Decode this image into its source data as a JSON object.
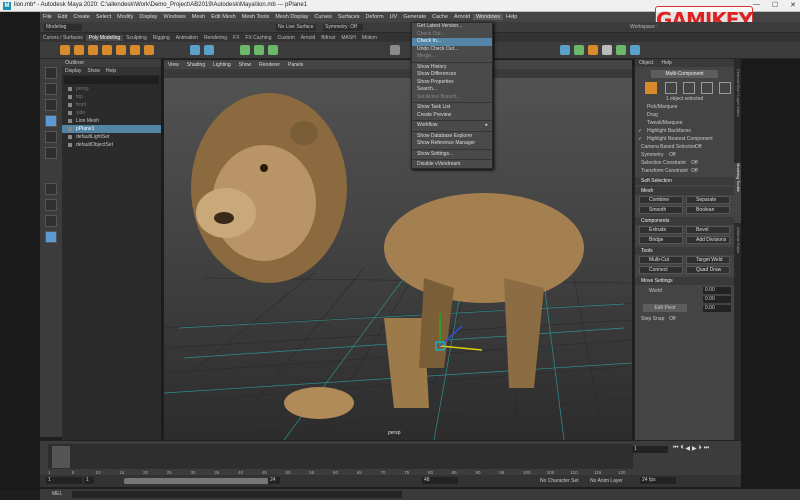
{
  "window": {
    "title": "lion.mb* - Autodesk Maya 2020: C:\\allendesk\\Work\\Demo_Project\\AB2019\\Autodesk\\Maya\\lion.mb  ---  pPlane1",
    "controls": [
      "—",
      "☐",
      "✕"
    ]
  },
  "watermark": "GAMIKEY",
  "menubar": [
    "File",
    "Edit",
    "Create",
    "Select",
    "Modify",
    "Display",
    "Windows",
    "Mesh",
    "Edit Mesh",
    "Mesh Tools",
    "Mesh Display",
    "Curves",
    "Surfaces",
    "Deform",
    "UV",
    "Generate",
    "Cache",
    "Arnold",
    "Wondows",
    "Help"
  ],
  "status_line": {
    "mode": "Modeling",
    "no_live": "No Live Surface",
    "symmetry": "Symmetry: Off",
    "workspace": "Workspace :"
  },
  "shelf_tabs": [
    "Curves / Surfaces",
    "Poly Modeling",
    "Sculpting",
    "Rigging",
    "Animation",
    "Rendering",
    "FX",
    "FX Caching",
    "Custom",
    "Arnold",
    "Bifrost",
    "MASH",
    "Motion"
  ],
  "active_shelf": "Poly Modeling",
  "outliner": {
    "title": "Outliner",
    "menu": [
      "Display",
      "Show",
      "Help"
    ],
    "items": [
      "persp",
      "top",
      "front",
      "side",
      "Lion Mesh",
      "pPlane1",
      "defaultLightSet",
      "defaultObjectSet"
    ],
    "selected": "pPlane1"
  },
  "viewport": {
    "menus": [
      "View",
      "Shading",
      "Lighting",
      "Show",
      "Renderer",
      "Panels"
    ],
    "camera": "persp"
  },
  "dropdown": [
    {
      "label": "Get Latest Version...",
      "state": "normal"
    },
    {
      "label": "Check Out...",
      "state": "disabled"
    },
    {
      "label": "Check In...",
      "state": "highlight"
    },
    {
      "label": "Undo Check Out...",
      "state": "normal"
    },
    {
      "label": "Merge...",
      "state": "disabled"
    },
    {
      "sep": true
    },
    {
      "label": "Show History",
      "state": "normal"
    },
    {
      "label": "Show Differences",
      "state": "normal"
    },
    {
      "label": "Show Properties",
      "state": "normal"
    },
    {
      "label": "Search...",
      "state": "normal"
    },
    {
      "label": "Set Active Branch...",
      "state": "disabled"
    },
    {
      "sep": true
    },
    {
      "label": "Show Task List",
      "state": "normal"
    },
    {
      "label": "Create Preview",
      "state": "normal"
    },
    {
      "sep": true
    },
    {
      "label": "Workflow",
      "state": "submenu"
    },
    {
      "sep": true
    },
    {
      "label": "Show Database Explorer",
      "state": "normal"
    },
    {
      "label": "Show Reference Manager",
      "state": "normal"
    },
    {
      "sep": true
    },
    {
      "label": "Show Settings...",
      "state": "normal"
    },
    {
      "sep": true
    },
    {
      "label": "Disable vVendream",
      "state": "normal"
    }
  ],
  "attr": {
    "tabs": [
      "Object",
      "Help"
    ],
    "multi": "Multi-Component",
    "selected": "1 object selected",
    "pick_opts": [
      "Pick/Marquee",
      "Drag",
      "Tweak/Marquee",
      "Highlight Backfaces",
      "Highlight Nearest Component"
    ],
    "cbs": "Camera Based Selection",
    "off": "Off",
    "symmetry": "Symmetry",
    "sel_constraint": "Selection Constraint",
    "tr_constraint": "Transform Constraint",
    "soft": "Soft Selection",
    "mesh_title": "Mesh",
    "mesh_btns": [
      "Combine",
      "Separate",
      "Smooth",
      "Boolean"
    ],
    "comp_title": "Components",
    "comp_btns": [
      "Extrude",
      "Bevel",
      "Bridge",
      "Add Divisions"
    ],
    "tools_title": "Tools",
    "tools_btns": [
      "Multi-Cut",
      "Target Weld",
      "Connect",
      "Quad Draw"
    ],
    "move_title": "Move Settings",
    "world": "World",
    "vals": [
      "0.00",
      "0.00",
      "0.00"
    ],
    "edit_pivot": "Edit Pivot",
    "step_snap": "Step Snap",
    "side_tabs": [
      "Channel Box / Layer Editor",
      "Modeling Toolkit",
      "Attribute Editor"
    ]
  },
  "timeline": {
    "ticks": [
      "1",
      "5",
      "10",
      "15",
      "20",
      "25",
      "30",
      "35",
      "40",
      "45",
      "50",
      "55",
      "60",
      "65",
      "70",
      "75",
      "80",
      "85",
      "90",
      "95",
      "100",
      "105",
      "110",
      "115",
      "120"
    ],
    "current": "1"
  },
  "range": {
    "start": "1",
    "in": "1",
    "out": "24",
    "end": "48",
    "fps": "24 fps",
    "char_set": "No Character Set",
    "anim_layer": "No Anim Layer"
  },
  "cmd": {
    "lang": "MEL"
  }
}
